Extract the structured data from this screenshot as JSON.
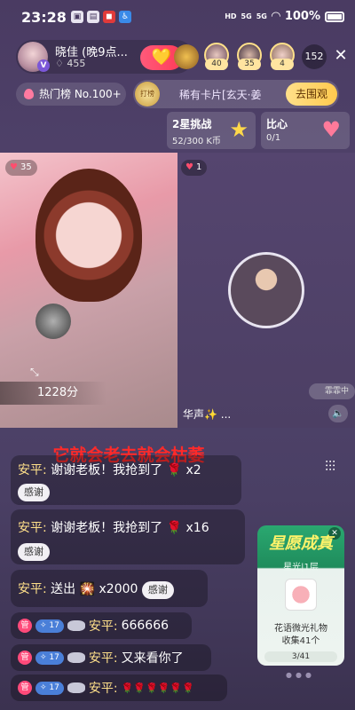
{
  "status_bar": {
    "time": "23:28",
    "network_1": "HD",
    "network_2": "5G",
    "network_3": "5G",
    "battery": "100%"
  },
  "host": {
    "name": "晓佳 (晚9点...",
    "badge": "V",
    "likes": "455"
  },
  "viewers": [
    {
      "level": "40"
    },
    {
      "level": "35"
    },
    {
      "level": "4"
    }
  ],
  "viewer_count": "152",
  "hot_rank": "热门榜 No.100+",
  "card_banner": {
    "icon_text": "打榜",
    "text": "稀有卡片[玄天·姜",
    "button": "去围观"
  },
  "tasks": [
    {
      "title": "2星挑战",
      "progress": "52/300 K币"
    },
    {
      "title": "比心",
      "progress": "0/1"
    }
  ],
  "left_pane": {
    "hearts": "35",
    "score": "1228分"
  },
  "right_pane": {
    "hearts": "1",
    "guest_name": "华声✨ ...",
    "watermark": "霏霏中"
  },
  "caption": "它就会老去就会枯萎",
  "chat": {
    "m1": {
      "user": "安平:",
      "text": "谢谢老板！我抢到了",
      "count": "x2",
      "thanks": "感谢"
    },
    "m2": {
      "user": "安平:",
      "text": "谢谢老板！我抢到了",
      "count": "x16",
      "thanks": "感谢"
    },
    "m3": {
      "user": "安平:",
      "text": "送出",
      "count": "x2000",
      "thanks": "感谢"
    },
    "m4": {
      "role": "管",
      "level": "17",
      "user": "安平:",
      "text": "666666"
    },
    "m5": {
      "role": "管",
      "level": "17",
      "user": "安平:",
      "text": "又来看你了"
    },
    "m6": {
      "role": "管",
      "level": "17",
      "user": "安平:",
      "text": "🌹🌹🌹🌹🌹🌹"
    }
  },
  "promo": {
    "title": "星愿成真",
    "subtitle": "星光|1层",
    "gift": "花语微光礼物",
    "collect": "收集41个",
    "progress": "3/41"
  }
}
